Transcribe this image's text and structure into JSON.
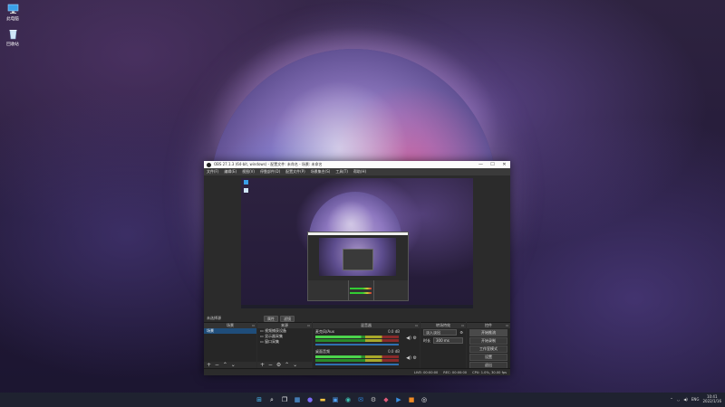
{
  "desktop": {
    "icons": [
      {
        "label": "此电脑",
        "icon": "computer-icon"
      },
      {
        "label": "回收站",
        "icon": "recycle-bin-icon"
      }
    ]
  },
  "obs_window": {
    "title": "OBS 27.1.3 (64-bit, windows) - 配置文件: 未命名 - 场景: 未命名",
    "controls": {
      "minimize": "—",
      "maximize": "☐",
      "close": "✕"
    },
    "menu": [
      "文件(F)",
      "编辑(E)",
      "视图(V)",
      "停靠部件(D)",
      "配置文件(P)",
      "场景集合(S)",
      "工具(T)",
      "帮助(H)"
    ],
    "context_bar": {
      "no_source": "未选择源",
      "properties": "属性",
      "filters": "滤镜"
    },
    "docks": {
      "scenes": {
        "title": "场景",
        "items": [
          "场景"
        ],
        "tools": "+ − ⌃ ⌄"
      },
      "sources": {
        "title": "来源",
        "items": [
          "视频捕获设备",
          "显示器采集",
          "窗口采集"
        ],
        "tools": "+ − ⚙ ⌃ ⌄"
      },
      "mixer": {
        "title": "混音器",
        "channels": [
          {
            "name": "麦克风/Aux",
            "db": "0.0 dB"
          },
          {
            "name": "桌面音频",
            "db": "0.0 dB"
          }
        ]
      },
      "transitions": {
        "title": "转场特效",
        "type": "淡入淡出",
        "duration_label": "时长",
        "duration": "300 ms"
      },
      "controls": {
        "title": "控件",
        "buttons": [
          "开始推流",
          "开始录制",
          "工作室模式",
          "设置",
          "退出"
        ]
      }
    },
    "status": {
      "live": "LIVE: 00:00:00",
      "rec": "REC: 00:00:00",
      "cpu": "CPU: 1.0%, 30.00 fps"
    }
  },
  "taskbar": {
    "apps": [
      "windows-start-icon",
      "search-icon",
      "task-view-icon",
      "widgets-icon",
      "chat-icon",
      "explorer-icon",
      "store-icon",
      "edge-icon",
      "mail-icon",
      "settings-icon",
      "photos-icon",
      "media-icon",
      "terminal-icon",
      "obs-icon"
    ],
    "tray": {
      "lang": "ENG",
      "time": "10:41",
      "date": "2022/1/16"
    }
  },
  "colors": {
    "obs_bg": "#2b2b2b",
    "selection": "#1f4d7a",
    "accent": "#2f6fb0"
  }
}
